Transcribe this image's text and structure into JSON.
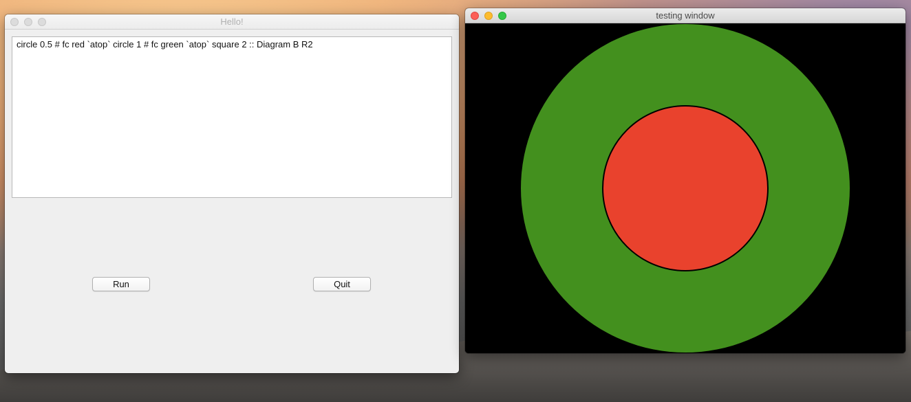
{
  "hello_window": {
    "title": "Hello!",
    "editor_text": "circle 0.5 # fc red `atop` circle 1 # fc green `atop` square 2 :: Diagram B R2",
    "run_label": "Run",
    "quit_label": "Quit"
  },
  "testing_window": {
    "title": "testing window",
    "diagram": {
      "background_color": "#000000",
      "outer_circle": {
        "shape": "circle",
        "radius": 1,
        "fill": "#43901e"
      },
      "inner_circle": {
        "shape": "circle",
        "radius": 0.5,
        "fill": "#e9422d",
        "stroke": "#000000"
      },
      "square": {
        "shape": "square",
        "side": 2,
        "fill": "#000000"
      }
    }
  },
  "window_controls": {
    "close_color": "#fc5f57",
    "minimize_color": "#fdbc2e",
    "zoom_color": "#34c748"
  }
}
